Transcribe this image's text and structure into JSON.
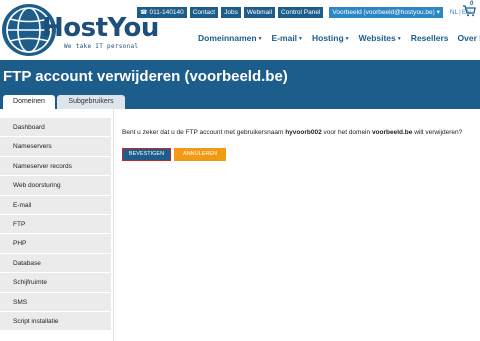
{
  "header": {
    "logo_name": "HostYou",
    "logo_tagline": "We take IT personal",
    "phone": "011-140140",
    "top_links": [
      "Contact",
      "Jobs",
      "Webmail",
      "Control Panel"
    ],
    "account_label": "Voorbeeld (voorbeeld@hostyou.be)",
    "languages": [
      "NL",
      "EN"
    ],
    "cart_count": "0",
    "nav": [
      {
        "label": "Domeinnamen",
        "has_menu": true
      },
      {
        "label": "E-mail",
        "has_menu": true
      },
      {
        "label": "Hosting",
        "has_menu": true
      },
      {
        "label": "Websites",
        "has_menu": true
      },
      {
        "label": "Resellers",
        "has_menu": false
      },
      {
        "label": "Over HostYou",
        "has_menu": false
      }
    ]
  },
  "banner": {
    "title": "FTP account verwijderen (voorbeeld.be)",
    "tabs": [
      "Domeinen",
      "Subgebruikers"
    ]
  },
  "sidebar": {
    "items": [
      "Dashboard",
      "Nameservers",
      "Nameserver records",
      "Web doorsturing",
      "E-mail",
      "FTP",
      "PHP",
      "Database",
      "Schijfruimte",
      "SMS",
      "Script installatie"
    ]
  },
  "content": {
    "text_before": "Bent u zeker dat u de FTP account met gebruikersnaam ",
    "username": "hyvoorb002",
    "text_middle": " voor het domein ",
    "domain": "voorbeeld.be",
    "text_after": " wilt verwijderen?",
    "confirm_label": "BEVESTIGEN",
    "cancel_label": "ANNULEREN"
  },
  "colors": {
    "brand_blue": "#1d5d8c",
    "accent_orange": "#f39a14",
    "focus_red": "#c92424"
  }
}
